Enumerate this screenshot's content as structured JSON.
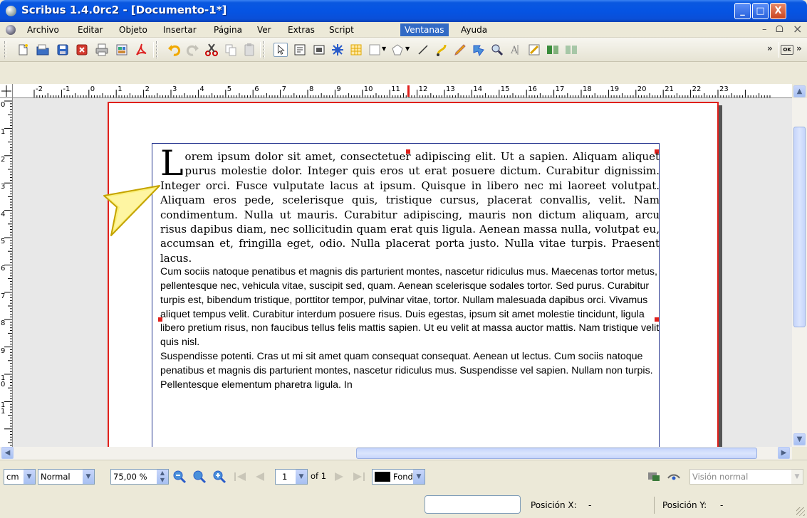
{
  "window": {
    "title": "Scribus 1.4.0rc2 - [Documento-1*]",
    "minimize": "_",
    "maximize": "□",
    "close": "X"
  },
  "menubar": {
    "items": [
      {
        "label": "Archivo"
      },
      {
        "label": "Editar"
      },
      {
        "label": "Objeto"
      },
      {
        "label": "Insertar"
      },
      {
        "label": "Página"
      },
      {
        "label": "Ver"
      },
      {
        "label": "Extras"
      },
      {
        "label": "Script"
      },
      {
        "label": "Ventanas",
        "active": true
      },
      {
        "label": "Ayuda"
      }
    ],
    "mdi_minimize": "–",
    "mdi_restore": "ᗝ",
    "mdi_close": "×"
  },
  "toolbar": {
    "more_1": "»",
    "more_2": "»",
    "ok_label": "OK"
  },
  "ruler": {
    "h_labels": [
      "-2",
      "-1",
      "0",
      "1",
      "2",
      "3",
      "4",
      "5",
      "6",
      "7",
      "8",
      "9",
      "10",
      "11",
      "12",
      "13",
      "14",
      "15",
      "16",
      "17",
      "18",
      "19",
      "20",
      "21",
      "22",
      "23"
    ],
    "v_labels": [
      "0",
      "1",
      "2",
      "3",
      "4",
      "5",
      "6",
      "7",
      "8",
      "9",
      "10",
      "11"
    ]
  },
  "document": {
    "dropcap": "L",
    "para1": "orem ipsum dolor sit amet, consectetuer adipiscing elit. Ut a sapien. Aliquam aliquet purus molestie dolor. Integer quis eros ut erat posuere dictum. Curabitur dignissim. Integer orci. Fusce vulputate lacus at ipsum. Quisque in libero nec mi laoreet volutpat. Aliquam eros pede, scelerisque quis, tristique cursus, placerat convallis, velit. Nam condimentum. Nulla ut mauris. Curabitur adipiscing, mauris non dictum aliquam, arcu risus dapibus diam, nec sollicitudin quam erat quis ligula. Aenean massa nulla, volutpat eu, accumsan et, fringilla eget, odio. Nulla placerat porta justo. Nulla vitae turpis. Praesent lacus.",
    "para2": "Cum sociis natoque penatibus et magnis dis parturient montes, nascetur ridiculus mus. Maecenas tortor metus, pellentesque nec, vehicula vitae, suscipit sed, quam. Aenean scelerisque sodales tortor. Sed purus. Curabitur turpis est, bibendum tristique, porttitor tempor, pulvinar vitae, tortor. Nullam malesuada dapibus orci. Vivamus aliquet tempus velit. Curabitur interdum posuere risus. Duis egestas, ipsum sit amet molestie tincidunt, ligula libero pretium risus, non faucibus tellus felis mattis sapien. Ut eu velit at massa auctor mattis. Nam tristique velit quis nisl.",
    "para3": "Suspendisse potenti. Cras ut mi sit amet quam consequat consequat. Aenean ut lectus. Cum sociis natoque penatibus et magnis dis parturient montes, nascetur ridiculus mus. Suspendisse vel sapien. Nullam non turpis. Pellentesque elementum pharetra ligula. In"
  },
  "bottombar": {
    "unit": "cm",
    "mode": "Normal",
    "zoom": "75,00 %",
    "page_current": "1",
    "page_of": "of 1",
    "layer": "Fondo",
    "view_mode": "Visión normal"
  },
  "statusbar": {
    "pos_x_label": "Posición X:",
    "pos_x_value": "-",
    "pos_y_label": "Posición Y:",
    "pos_y_value": "-"
  }
}
